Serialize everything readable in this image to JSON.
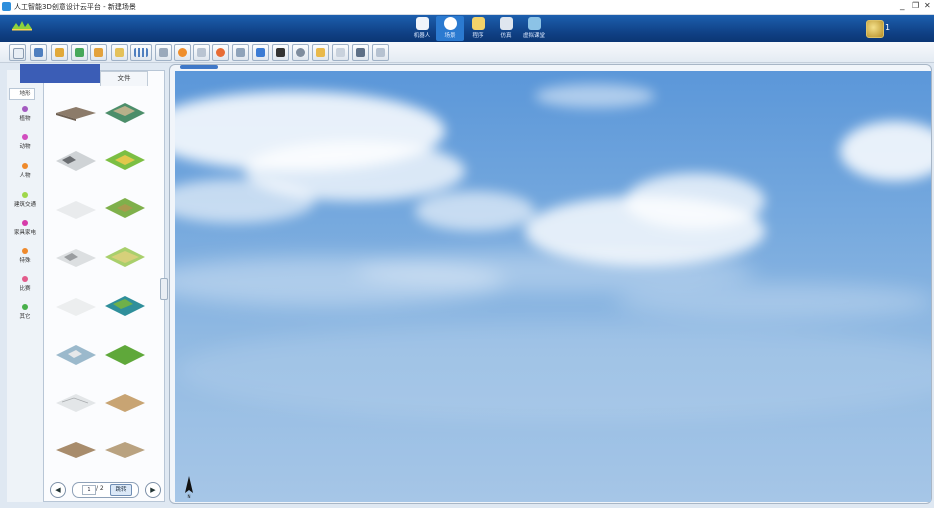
{
  "window": {
    "title": "人工智能3D创意设计云平台 - 新建场景",
    "minimize": "_",
    "restore": "❐",
    "close": "✕"
  },
  "nav": {
    "tabs": [
      {
        "label": "机器人",
        "icon": "robot-icon",
        "active": false
      },
      {
        "label": "场景",
        "icon": "scene-icon",
        "active": true
      },
      {
        "label": "程序",
        "icon": "program-icon",
        "active": false
      },
      {
        "label": "仿真",
        "icon": "simulation-icon",
        "active": false
      },
      {
        "label": "虚拟课堂",
        "icon": "virtual-classroom-icon",
        "active": false
      }
    ],
    "user_count": "1"
  },
  "sidebar": {
    "tab_file": "文件",
    "categories": [
      {
        "label": "地形",
        "color": "#6c8fd1"
      },
      {
        "label": "植物",
        "color": "#a35ac0"
      },
      {
        "label": "动物",
        "color": "#d14dbf"
      },
      {
        "label": "人物",
        "color": "#ef8a2c"
      },
      {
        "label": "建筑交通",
        "color": "#9fd74a"
      },
      {
        "label": "家具家电",
        "color": "#d63aa9"
      },
      {
        "label": "特殊",
        "color": "#ef8a2c"
      },
      {
        "label": "比赛",
        "color": "#e25b8b"
      },
      {
        "label": "其它",
        "color": "#48b04b"
      }
    ]
  },
  "pager": {
    "prev": "◀",
    "next": "▶",
    "current": "1",
    "total": "/ 2",
    "jump_label": "跳转"
  },
  "viewport": {
    "compass_label": "N"
  },
  "colors": {
    "nav_bg": "#134a93",
    "sky_top": "#5b97d9",
    "sky_bottom": "#a6c6e7",
    "panel_tab_active": "#3b5db6"
  }
}
